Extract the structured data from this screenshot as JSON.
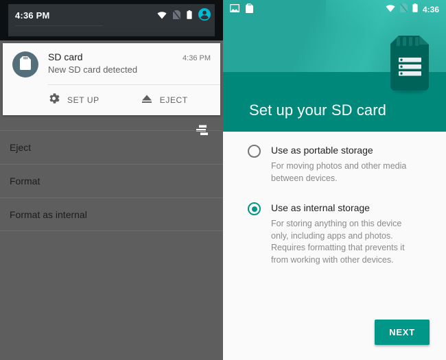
{
  "left_panel": {
    "status_bar": {
      "clock": "4:36 PM",
      "icons": [
        "wifi-icon",
        "no-sim-icon",
        "battery-icon",
        "user-avatar-icon"
      ]
    },
    "notification": {
      "icon": "sd-card-icon",
      "title": "SD card",
      "time": "4:36 PM",
      "subtitle": "New SD card detected",
      "actions": [
        {
          "icon": "gear-icon",
          "label": "SET UP"
        },
        {
          "icon": "eject-icon",
          "label": "EJECT"
        }
      ]
    },
    "overlay": {
      "sort_icon": "sort-icon",
      "menu_items": [
        {
          "label": "Eject"
        },
        {
          "label": "Format"
        },
        {
          "label": "Format as internal"
        }
      ]
    }
  },
  "right_panel": {
    "status_bar": {
      "clock": "4:36",
      "left_icons": [
        "screenshot-icon",
        "sd-card-icon"
      ],
      "right_icons": [
        "wifi-icon",
        "no-sim-icon",
        "battery-icon"
      ]
    },
    "header": {
      "title": "Set up your SD card",
      "illustration": "sd-card-illustration"
    },
    "options": [
      {
        "label": "Use as portable storage",
        "description": "For moving photos and other media between devices.",
        "selected": false
      },
      {
        "label": "Use as internal storage",
        "description": "For storing anything on this device only, including apps and photos. Requires formatting that prevents it from working with other devices.",
        "selected": true
      }
    ],
    "next_button": "NEXT"
  },
  "colors": {
    "teal_primary": "#26a69a",
    "teal_dark": "#00897b",
    "accent": "#009688",
    "scrim_gray": "#5e5e5e",
    "status_dark": "#2e3338",
    "avatar_cyan": "#00bcd4"
  }
}
